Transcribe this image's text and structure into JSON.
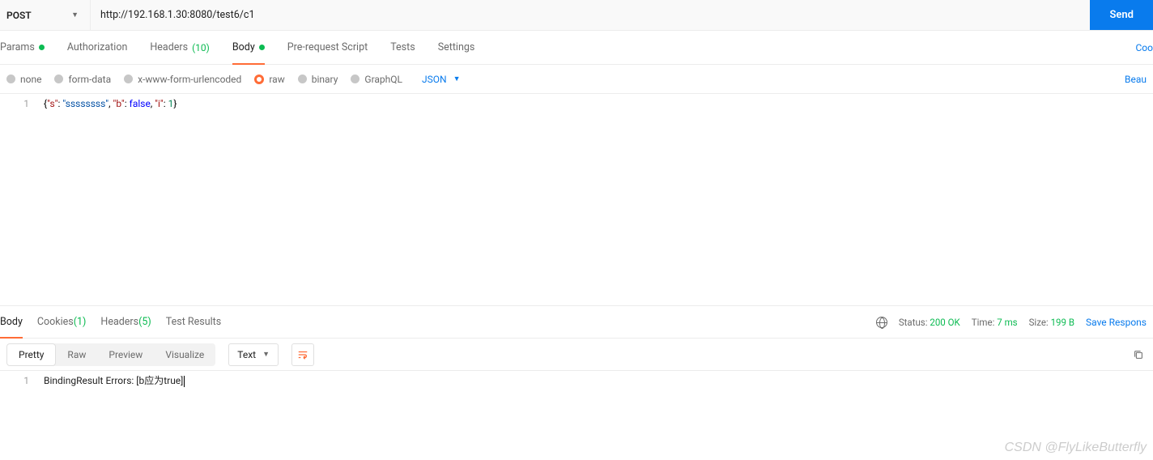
{
  "request": {
    "method": "POST",
    "url": "http://192.168.1.30:8080/test6/c1",
    "send_label": "Send"
  },
  "tabs": {
    "params": "Params",
    "authorization": "Authorization",
    "headers": "Headers",
    "headers_count": "(10)",
    "body": "Body",
    "prerequest": "Pre-request Script",
    "tests": "Tests",
    "settings": "Settings",
    "cookies_link": "Coo"
  },
  "body": {
    "types": {
      "none": "none",
      "formdata": "form-data",
      "xwww": "x-www-form-urlencoded",
      "raw": "raw",
      "binary": "binary",
      "graphql": "GraphQL"
    },
    "lang": "JSON",
    "beautify": "Beau",
    "line_no": "1",
    "code_tokens": {
      "open": "{",
      "k1": "\"s\"",
      "c1": ": ",
      "v1": "\"ssssssss\"",
      "s1": ", ",
      "k2": "\"b\"",
      "c2": ": ",
      "v2": "false",
      "s2": ", ",
      "k3": "\"i\"",
      "c3": ": ",
      "v3": "1",
      "close": "}"
    }
  },
  "response": {
    "tabs": {
      "body": "Body",
      "cookies": "Cookies",
      "cookies_count": "(1)",
      "headers": "Headers",
      "headers_count": "(5)",
      "tests": "Test Results"
    },
    "status_label": "Status:",
    "status_value": "200 OK",
    "time_label": "Time:",
    "time_value": "7 ms",
    "size_label": "Size:",
    "size_value": "199 B",
    "save_label": "Save Respons",
    "view": {
      "pretty": "Pretty",
      "raw": "Raw",
      "preview": "Preview",
      "visualize": "Visualize",
      "format": "Text"
    },
    "line_no": "1",
    "code": "BindingResult Errors: [b应为true]"
  },
  "watermark": "CSDN @FlyLikeButterfly"
}
